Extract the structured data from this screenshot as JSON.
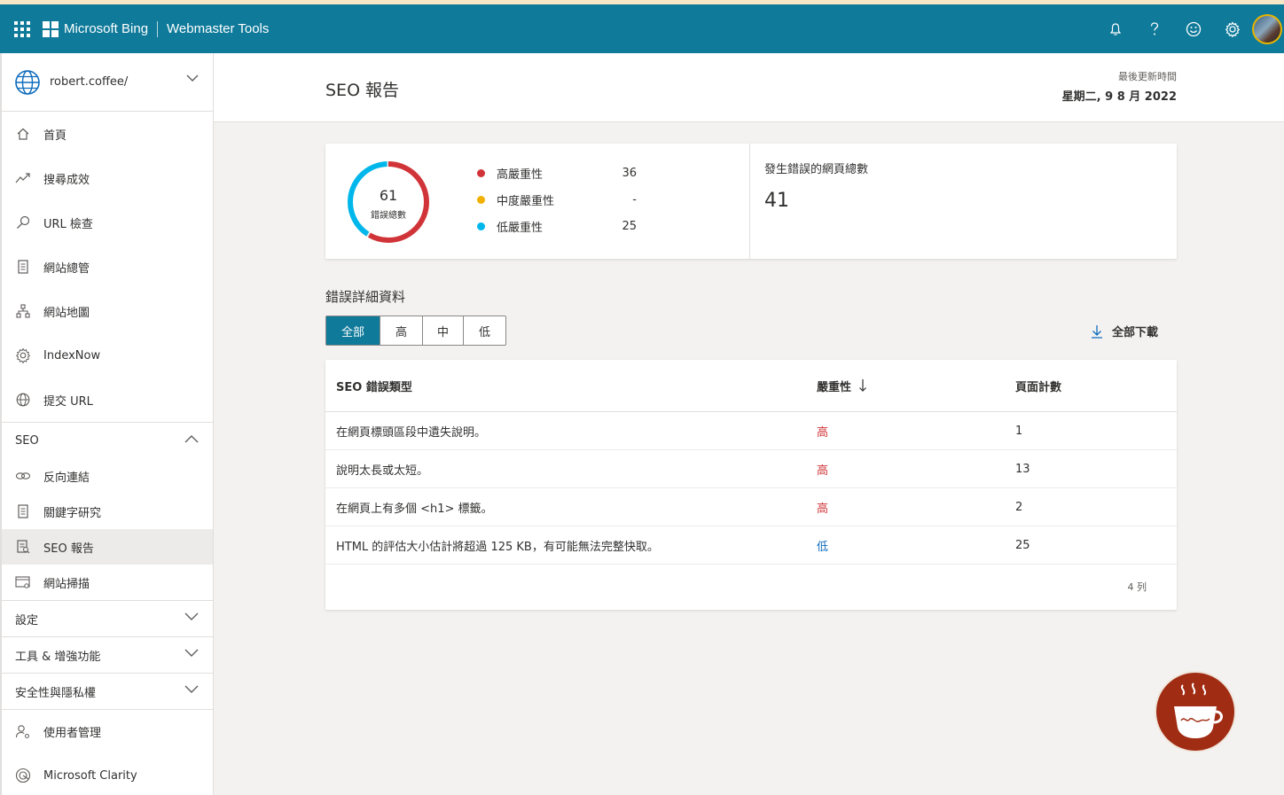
{
  "topbar": {
    "brand": "Microsoft Bing",
    "product": "Webmaster Tools",
    "accent": "#0f7a9a"
  },
  "sidebar": {
    "site": "robert.coffee/",
    "items": [
      {
        "label": "首頁",
        "icon": "home-icon"
      },
      {
        "label": "搜尋成效",
        "icon": "trend-icon"
      },
      {
        "label": "URL 檢查",
        "icon": "search-icon"
      },
      {
        "label": "網站總管",
        "icon": "document-icon"
      },
      {
        "label": "網站地圖",
        "icon": "sitemap-icon"
      },
      {
        "label": "IndexNow",
        "icon": "gear-icon"
      },
      {
        "label": "提交 URL",
        "icon": "globe-icon"
      }
    ],
    "seo_group": "SEO",
    "seo_items": [
      {
        "label": "反向連結",
        "icon": "link-icon"
      },
      {
        "label": "關鍵字研究",
        "icon": "document-icon"
      },
      {
        "label": "SEO 報告",
        "icon": "report-icon"
      },
      {
        "label": "網站掃描",
        "icon": "scan-icon"
      }
    ],
    "groups": [
      "設定",
      "工具 & 增強功能",
      "安全性與隱私權"
    ],
    "bottom_items": [
      {
        "label": "使用者管理",
        "icon": "user-settings-icon"
      },
      {
        "label": "Microsoft Clarity",
        "icon": "clarity-icon"
      }
    ]
  },
  "header": {
    "title": "SEO 報告",
    "updated_label": "最後更新時間",
    "updated_date": "星期二, 9 8 月 2022"
  },
  "summary": {
    "total_errors": "61",
    "total_label": "錯誤總數",
    "legend": [
      {
        "label": "高嚴重性",
        "value": "36",
        "color": "#d13438"
      },
      {
        "label": "中度嚴重性",
        "value": "-",
        "color": "#f2b000"
      },
      {
        "label": "低嚴重性",
        "value": "25",
        "color": "#00b7eb"
      }
    ],
    "pages_title": "發生錯誤的網頁總數",
    "pages_value": "41"
  },
  "details": {
    "title": "錯誤詳細資料",
    "filters": [
      "全部",
      "高",
      "中",
      "低"
    ],
    "active_filter": "全部",
    "download_label": "全部下載",
    "columns": [
      "SEO 錯誤類型",
      "嚴重性",
      "頁面計數"
    ],
    "rows": [
      {
        "type": "在網頁標頭區段中遺失說明。",
        "severity": "高",
        "count": "1"
      },
      {
        "type": "說明太長或太短。",
        "severity": "高",
        "count": "13"
      },
      {
        "type": "在網頁上有多個 <h1> 標籤。",
        "severity": "高",
        "count": "2"
      },
      {
        "type": "HTML 的評估大小估計將超過 125 KB，有可能無法完整快取。",
        "severity": "低",
        "count": "25"
      }
    ],
    "row_count": "4 列"
  }
}
